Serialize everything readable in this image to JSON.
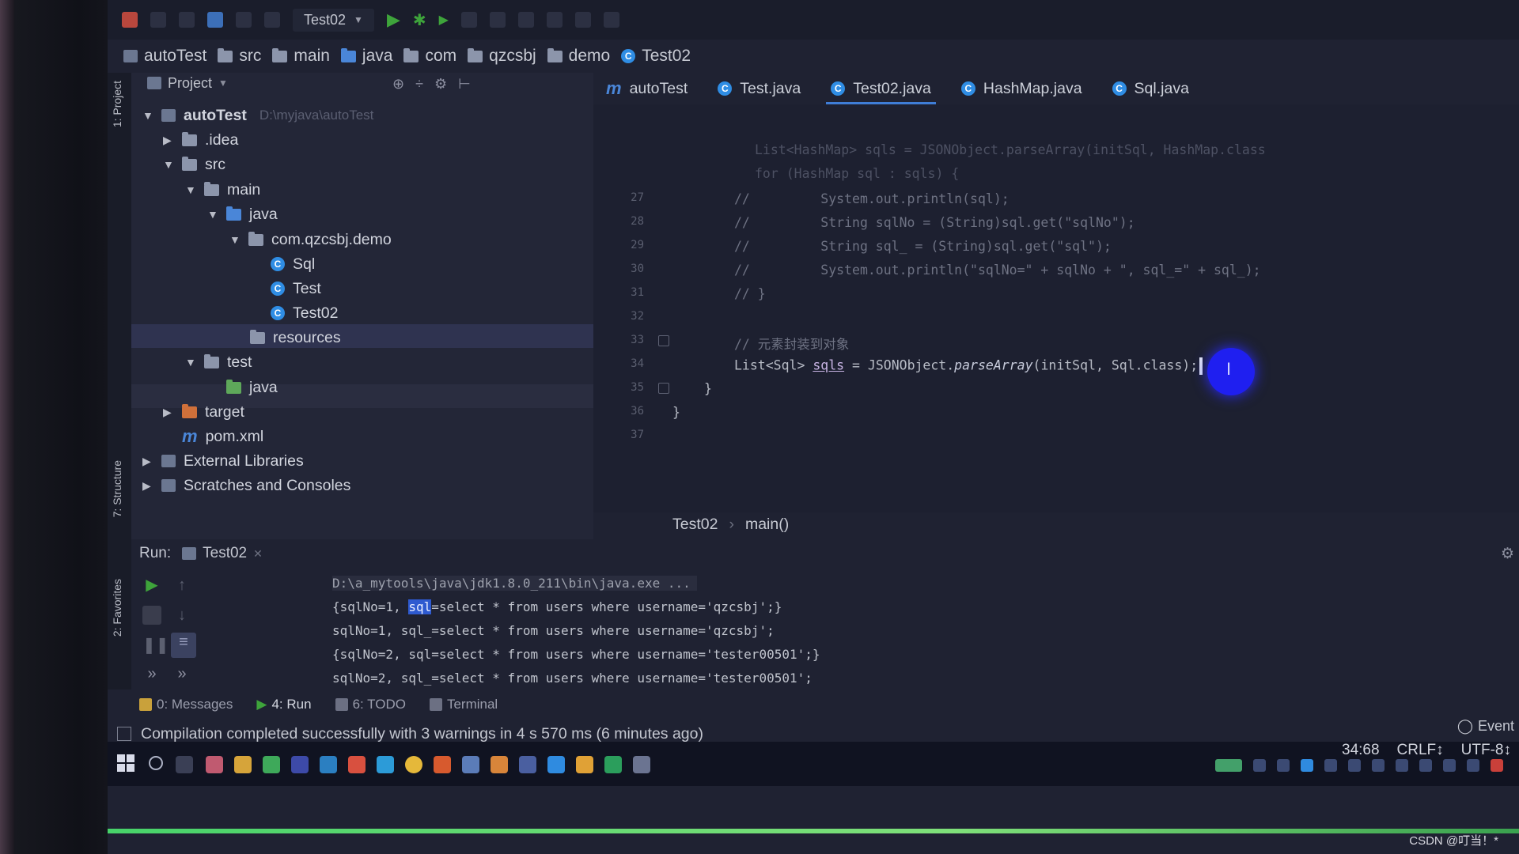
{
  "toolbar": {
    "run_config": "Test02"
  },
  "breadcrumb": [
    "autoTest",
    "src",
    "main",
    "java",
    "com",
    "qzcsbj",
    "demo",
    "Test02"
  ],
  "side_tabs": {
    "project": "1: Project",
    "structure": "7: Structure",
    "favorites": "2: Favorites"
  },
  "project": {
    "title": "Project",
    "tree": [
      {
        "label": "autoTest",
        "path": "D:\\myjava\\autoTest"
      },
      {
        "label": ".idea"
      },
      {
        "label": "src"
      },
      {
        "label": "main"
      },
      {
        "label": "java"
      },
      {
        "label": "com.qzcsbj.demo"
      },
      {
        "label": "Sql"
      },
      {
        "label": "Test"
      },
      {
        "label": "Test02"
      },
      {
        "label": "resources"
      },
      {
        "label": "test"
      },
      {
        "label": "java"
      },
      {
        "label": "target"
      },
      {
        "label": "pom.xml"
      },
      {
        "label": "External Libraries"
      },
      {
        "label": "Scratches and Consoles"
      }
    ]
  },
  "editor": {
    "tabs": [
      "autoTest",
      "Test.java",
      "Test02.java",
      "HashMap.java",
      "Sql.java"
    ],
    "active_tab": "Test02.java",
    "line_numbers": [
      "27",
      "28",
      "29",
      "30",
      "31",
      "32",
      "33",
      "34",
      "35",
      "36",
      "37"
    ],
    "code": {
      "l_a": "List<HashMap> sqls = JSONObject.parseArray(initSql, HashMap.class",
      "l_b": "for (HashMap sql : sqls) {",
      "l27": "//         System.out.println(sql);",
      "l28": "//         String sqlNo = (String)sql.get(\"sqlNo\");",
      "l29": "//         String sql_ = (String)sql.get(\"sql\");",
      "l30": "//         System.out.println(\"sqlNo=\" + sqlNo + \", sql_=\" + sql_);",
      "l31": "// }",
      "l33": "// 元素封装到对象",
      "l34_a": "List<Sql> ",
      "l34_var": "sqls",
      "l34_b": " = JSONObject.",
      "l34_method": "parseArray",
      "l34_c": "(initSql, Sql.class);",
      "l35": "}",
      "l36": "}"
    },
    "crumb_class": "Test02",
    "crumb_method": "main()"
  },
  "run": {
    "label": "Run:",
    "tab": "Test02",
    "console": {
      "line0": "D:\\a_mytools\\java\\jdk1.8.0_211\\bin\\java.exe ...",
      "line1_pre": "{sqlNo=1, ",
      "line1_sel": "sql",
      "line1_post": "=select * from users where username='qzcsbj';}",
      "line2": "sqlNo=1, sql_=select * from users where username='qzcsbj';",
      "line3": "{sqlNo=2, sql=select * from users where username='tester00501';}",
      "line4": "sqlNo=2, sql_=select * from users where username='tester00501';"
    }
  },
  "tool_tabs": [
    "0: Messages",
    "4: Run",
    "6: TODO",
    "Terminal"
  ],
  "status": {
    "message": "Compilation completed successfully with 3 warnings in 4 s 570 ms (6 minutes ago)",
    "position": "34:68",
    "line_sep": "CRLF↕",
    "encoding": "UTF-8↕",
    "event_log": "Event"
  },
  "watermark": "CSDN @叮当！*",
  "colors": {
    "accent": "#3f7dd6",
    "run_green": "#3ea43b",
    "selection": "#2e5ad0",
    "pointer": "#1f1ff0"
  }
}
